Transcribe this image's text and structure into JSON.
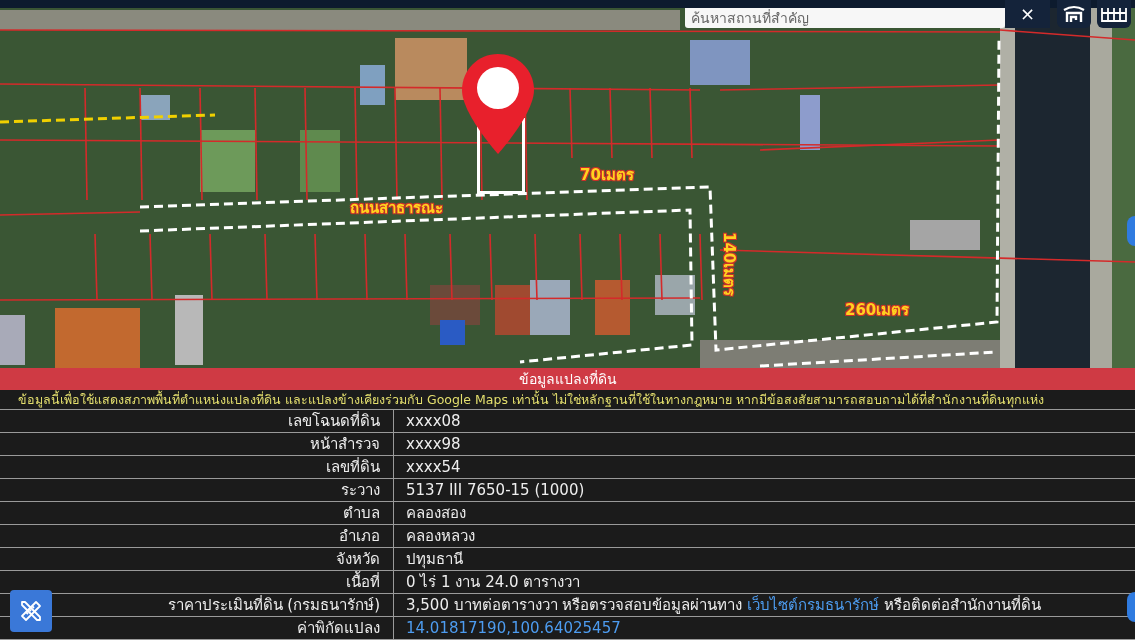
{
  "map": {
    "search": {
      "placeholder": "ค้นหาสถานที่สำคัญ"
    },
    "close_button": "×",
    "annotations": [
      {
        "text": "70เมตร",
        "kind": "horizontal"
      },
      {
        "text": "ถนนสาธารณะ",
        "kind": "horizontal"
      },
      {
        "text": "140เมตร",
        "kind": "vertical"
      },
      {
        "text": "260เมตร",
        "kind": "horizontal"
      }
    ]
  },
  "panel": {
    "title": "ข้อมูลแปลงที่ดิน",
    "disclaimer": "ข้อมูลนี้เพื่อใช้แสดงสภาพพื้นที่ตำแหน่งแปลงที่ดิน และแปลงข้างเคียงร่วมกับ Google Maps เท่านั้น ไม่ใช่หลักฐานที่ใช้ในทางกฎหมาย หากมีข้อสงสัยสามารถสอบถามได้ที่สำนักงานที่ดินทุกแห่ง",
    "rows": [
      {
        "label": "เลขโฉนดที่ดิน",
        "kind": "text",
        "value": "xxxx08"
      },
      {
        "label": "หน้าสำรวจ",
        "kind": "text",
        "value": "xxxx98"
      },
      {
        "label": "เลขที่ดิน",
        "kind": "text",
        "value": "xxxx54"
      },
      {
        "label": "ระวาง",
        "kind": "text",
        "value": "5137 III 7650-15 (1000)"
      },
      {
        "label": "ตำบล",
        "kind": "text",
        "value": "คลองสอง"
      },
      {
        "label": "อำเภอ",
        "kind": "text",
        "value": "คลองหลวง"
      },
      {
        "label": "จังหวัด",
        "kind": "text",
        "value": "ปทุมธานี"
      },
      {
        "label": "เนื้อที่",
        "kind": "text",
        "value": "0 ไร่ 1 งาน 24.0 ตารางวา"
      },
      {
        "label": "ราคาประเมินที่ดิน (กรมธนารักษ์)",
        "kind": "text_with_link",
        "value": "3,500 บาทต่อตารางวา หรือตรวจสอบข้อมูลผ่านทาง",
        "link": "เว็บไซต์กรมธนารักษ์",
        "value_after": "หรือติดต่อสำนักงานที่ดิน"
      },
      {
        "label": "ค่าพิกัดแปลง",
        "kind": "link",
        "value": "14.01817190,100.64025457"
      }
    ]
  }
}
